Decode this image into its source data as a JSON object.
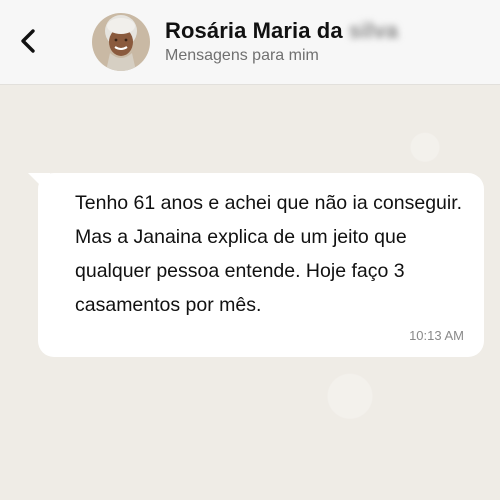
{
  "header": {
    "back_icon": "chevron-left-icon",
    "contact_name": "Rosária Maria da",
    "contact_name_blurred": "silva",
    "subtitle": "Mensagens para mim"
  },
  "message": {
    "text": "Tenho 61 anos e achei que não ia conseguir. Mas a Janaina explica de um jeito que qualquer pessoa entende. Hoje faço 3 casamentos por mês.",
    "time": "10:13 AM"
  },
  "colors": {
    "chat_background": "#efece6",
    "bubble": "#ffffff",
    "header_background": "#f7f7f7"
  }
}
